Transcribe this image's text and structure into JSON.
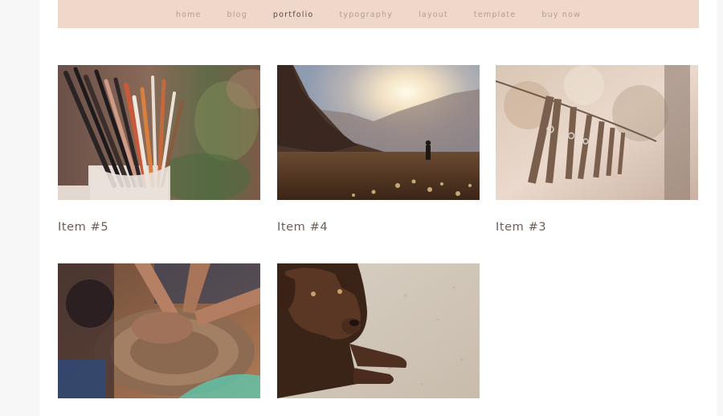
{
  "nav": {
    "items": [
      {
        "label": "home",
        "active": false
      },
      {
        "label": "blog",
        "active": false
      },
      {
        "label": "portfolio",
        "active": true
      },
      {
        "label": "typography",
        "active": false
      },
      {
        "label": "layout",
        "active": false
      },
      {
        "label": "template",
        "active": false
      },
      {
        "label": "buy now",
        "active": false
      }
    ]
  },
  "colors": {
    "nav_background": "#efd7ca",
    "nav_text": "#b39c90",
    "nav_active_text": "#5b4b44",
    "caption_text": "#6e5d55"
  },
  "portfolio": {
    "items": [
      {
        "title": "Item #5",
        "image": "paintbrushes-photo"
      },
      {
        "title": "Item #4",
        "image": "mountain-hiker-photo"
      },
      {
        "title": "Item #3",
        "image": "clothespins-photo"
      },
      {
        "title": "",
        "image": "pottery-wheel-photo"
      },
      {
        "title": "",
        "image": "brown-labrador-photo"
      }
    ]
  }
}
